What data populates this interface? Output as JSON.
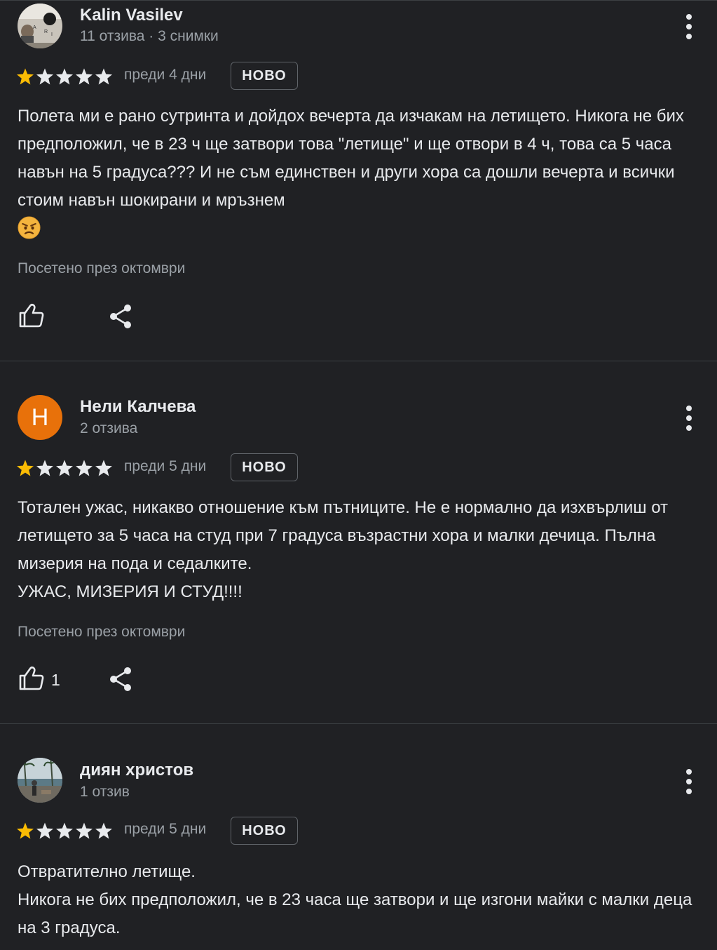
{
  "reviews": [
    {
      "author": "Kalin Vasilev",
      "meta": "11 отзива · 3 снимки",
      "avatar_type": "photo",
      "rating": 1,
      "max_rating": 5,
      "date": "преди 4 дни",
      "badge": "НОВО",
      "text": "Полета ми е рано сутринта и дойдох вечерта да изчакам на летището. Никога не бих предположил, че в 23 ч ще затвори това \"летище\" и ще отвори в 4 ч, това са 5 часа навън на 5 градуса??? И не съм единствен и други хора са дошли вечерта и всички стоим навън шокирани и мръзнем",
      "emoji": "angry-face-emoji",
      "visited": "Посетено през октомври",
      "likes": ""
    },
    {
      "author": "Нели Калчева",
      "meta": "2 отзива",
      "avatar_type": "letter",
      "avatar_letter": "Н",
      "avatar_color": "#e8710a",
      "rating": 1,
      "max_rating": 5,
      "date": "преди 5 дни",
      "badge": "НОВО",
      "text": "Тотален ужас, никакво отношение към пътниците. Не е нормално да изхвърлиш от летището за 5 часа на студ при 7 градуса възрастни хора и малки дечица. Пълна мизерия на пода и седалките.\nУЖАС, МИЗЕРИЯ И СТУД!!!!",
      "visited": "Посетено през октомври",
      "likes": "1"
    },
    {
      "author": "диян христов",
      "meta": "1 отзив",
      "avatar_type": "photo",
      "rating": 1,
      "max_rating": 5,
      "date": "преди 5 дни",
      "badge": "НОВО",
      "text": "Отвратително летище.\nНикога не бих предположил, че в 23 часа ще затвори и ще изгони майки с малки деца на 3 градуса."
    }
  ],
  "colors": {
    "background": "#202124",
    "star_filled": "#fbbc04",
    "star_empty": "#e8eaed",
    "secondary_text": "#9aa0a6"
  },
  "icons": {
    "more": "more-vert-icon",
    "like": "thumb-up-icon",
    "share": "share-icon"
  }
}
